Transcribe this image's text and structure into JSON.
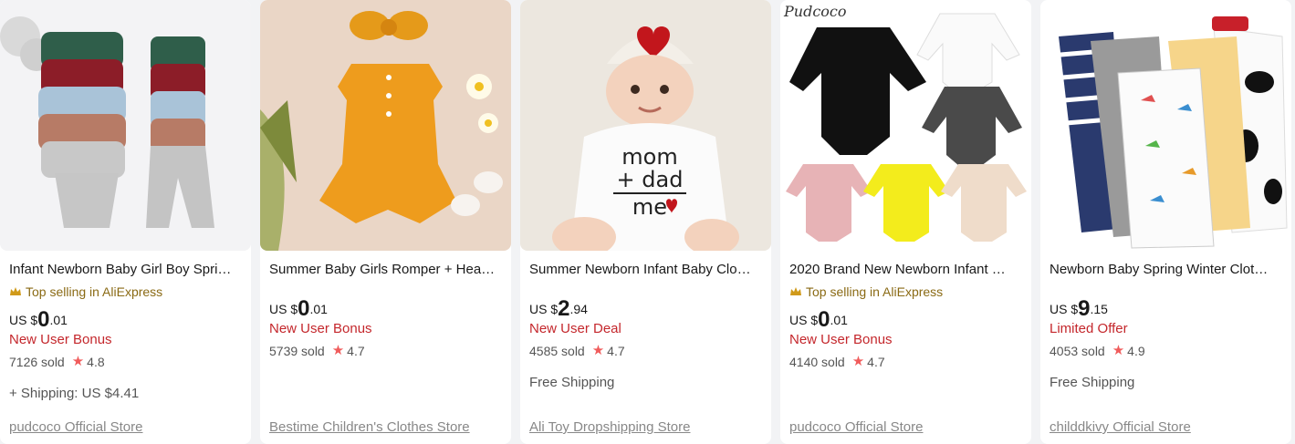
{
  "products": [
    {
      "title": "Infant Newborn Baby Girl Boy Spri…",
      "badge": "Top selling in AliExpress",
      "price_currency": "US $",
      "price_int": "0",
      "price_dec": ".01",
      "promo": "New User Bonus",
      "sold": "7126 sold",
      "rating": "4.8",
      "shipping": "+ Shipping: US $4.41",
      "store": "pudcoco Official Store",
      "image": "baby-clothes-set-photo"
    },
    {
      "title": "Summer Baby Girls Romper + Hea…",
      "badge": "",
      "price_currency": "US $",
      "price_int": "0",
      "price_dec": ".01",
      "promo": "New User Bonus",
      "sold": "5739 sold",
      "rating": "4.7",
      "shipping": "",
      "store": "Bestime Children's Clothes Store",
      "image": "yellow-romper-photo"
    },
    {
      "title": "Summer Newborn Infant Baby Clo…",
      "badge": "",
      "price_currency": "US $",
      "price_int": "2",
      "price_dec": ".94",
      "promo": "New User Deal",
      "sold": "4585 sold",
      "rating": "4.7",
      "shipping": "Free Shipping",
      "store": "Ali Toy Dropshipping Store",
      "image": "baby-mom-dad-me-photo"
    },
    {
      "title": "2020 Brand New Newborn Infant …",
      "badge": "Top selling in AliExpress",
      "price_currency": "US $",
      "price_int": "0",
      "price_dec": ".01",
      "promo": "New User Bonus",
      "sold": "4140 sold",
      "rating": "4.7",
      "shipping": "",
      "store": "pudcoco Official Store",
      "image": "ruffle-bodysuits-photo"
    },
    {
      "title": "Newborn Baby Spring Winter Clot…",
      "badge": "",
      "price_currency": "US $",
      "price_int": "9",
      "price_dec": ".15",
      "promo": "Limited Offer",
      "sold": "4053 sold",
      "rating": "4.9",
      "shipping": "Free Shipping",
      "store": "childdkivy Official Store",
      "image": "baby-jumpsuits-photo"
    }
  ],
  "image_text": {
    "mom": "mom",
    "dad": "+ dad",
    "me": "me",
    "pudcoco_logo": "Pudcoco"
  },
  "colors": {
    "promo_red": "#c4272c",
    "badge_gold": "#8a6a14",
    "star": "#f05b5b",
    "store_gray": "#888888"
  }
}
